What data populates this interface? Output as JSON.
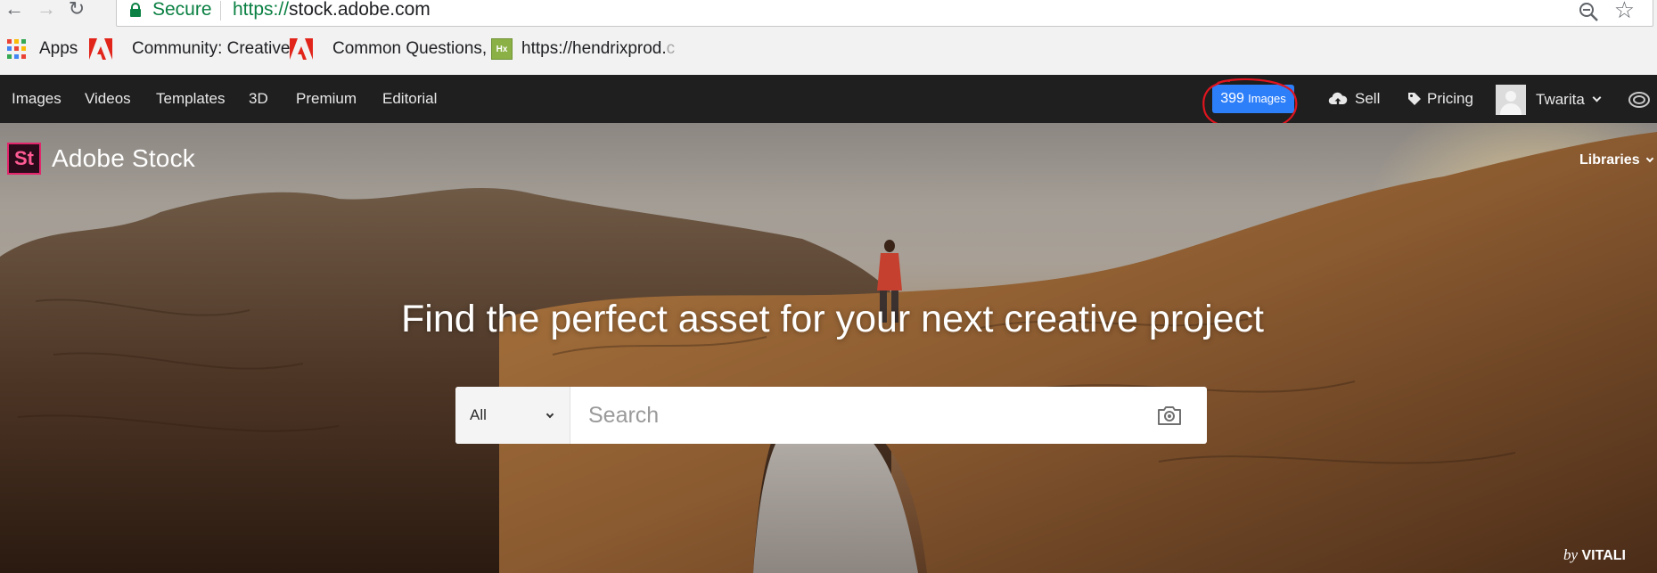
{
  "browser": {
    "secure_label": "Secure",
    "url_scheme": "https://",
    "url_host": "stock.adobe.com",
    "bookmarks": [
      {
        "label": "Apps",
        "icon": "apps-grid-icon"
      },
      {
        "label": "Community: Creative",
        "faded": "",
        "icon": "adobe-icon"
      },
      {
        "label": "Common Questions,",
        "faded": "",
        "icon": "adobe-icon"
      },
      {
        "label": "https://hendrixprod.",
        "faded": "c",
        "icon": "hx-icon"
      }
    ]
  },
  "topnav": {
    "links": [
      "Images",
      "Videos",
      "Templates",
      "3D",
      "Premium",
      "Editorial"
    ],
    "credits": {
      "count": "399",
      "unit": "Images"
    },
    "sell": "Sell",
    "pricing": "Pricing",
    "user": "Twarita"
  },
  "hero": {
    "logo_mark": "St",
    "logo_text": "Adobe Stock",
    "libraries": "Libraries",
    "headline": "Find the perfect asset for your next creative project",
    "search_scope": "All",
    "search_placeholder": "Search",
    "credit_by": "by",
    "credit_name": "VITALI"
  },
  "colors": {
    "nav_background": "#1f1f1f",
    "credits_button": "#2d7ff9",
    "annotation_circle": "#e0141e",
    "secure_green": "#0b8043",
    "stock_logo_pink": "#e3256b"
  }
}
